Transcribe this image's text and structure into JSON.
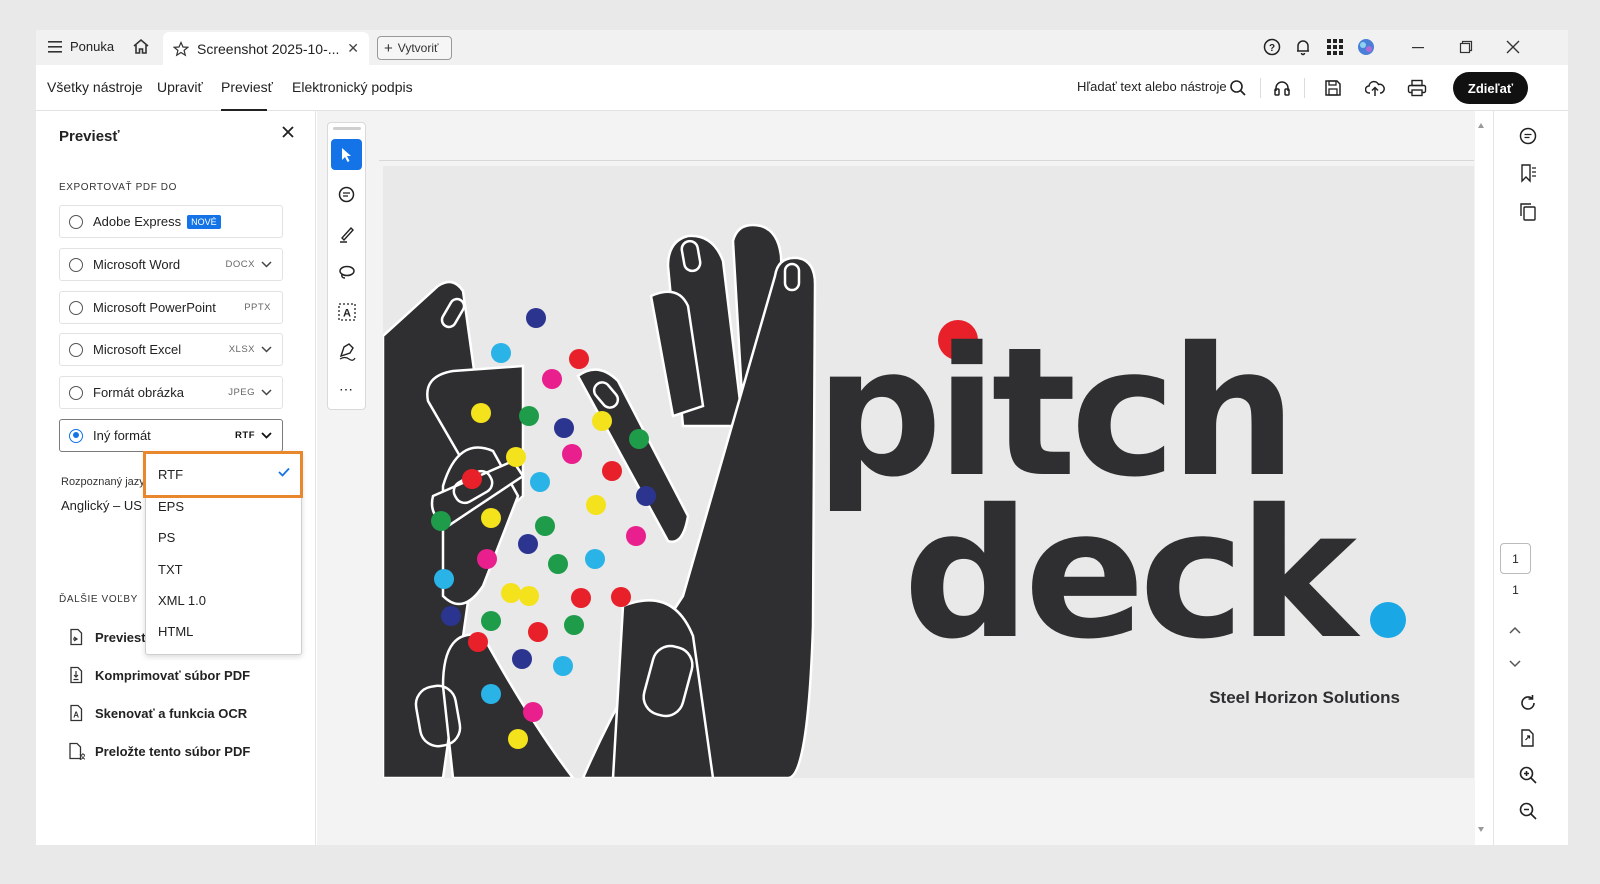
{
  "titlebar": {
    "menu_label": "Ponuka",
    "tab_title": "Screenshot 2025-10-...",
    "create_label": "Vytvoriť"
  },
  "menubar": {
    "items": [
      "Všetky nástroje",
      "Upraviť",
      "Previesť",
      "Elektronický podpis"
    ],
    "active": "Previesť",
    "search_label": "Hľadať text alebo nástroje",
    "share_label": "Zdieľať"
  },
  "left_panel": {
    "title": "Previesť",
    "export_section": "EXPORTOVAŤ PDF DO",
    "options": [
      {
        "label": "Adobe Express",
        "badge": "NOVÉ",
        "format": "",
        "selected": false
      },
      {
        "label": "Microsoft Word",
        "format": "DOCX",
        "selected": false
      },
      {
        "label": "Microsoft PowerPoint",
        "format": "PPTX",
        "selected": false
      },
      {
        "label": "Microsoft Excel",
        "format": "XLSX",
        "selected": false
      },
      {
        "label": "Formát obrázka",
        "format": "JPEG",
        "selected": false
      },
      {
        "label": "Iný formát",
        "format": "RTF",
        "selected": true
      }
    ],
    "recognized_language_label": "Rozpoznaný jazy",
    "recognized_language_value": "Anglický – US",
    "more_section": "ĎALŠIE VOĽBY",
    "more_items": [
      "Previesť",
      "Komprimovať súbor PDF",
      "Skenovať a funkcia OCR",
      "Preložte tento súbor PDF"
    ]
  },
  "dropdown": {
    "items": [
      "RTF",
      "EPS",
      "PS",
      "TXT",
      "XML 1.0",
      "HTML"
    ],
    "selected": "RTF"
  },
  "document": {
    "word1": "pitch",
    "word2": "deck",
    "dot": ".",
    "company": "Steel Horizon Solutions",
    "colors": {
      "red": "#e8202a",
      "blue": "#1aa7e6",
      "dark": "#2f2f31"
    }
  },
  "page_nav": {
    "current": "1",
    "total": "1"
  },
  "colors": {
    "accent": "#1473e6",
    "highlight": "#e8872b"
  }
}
